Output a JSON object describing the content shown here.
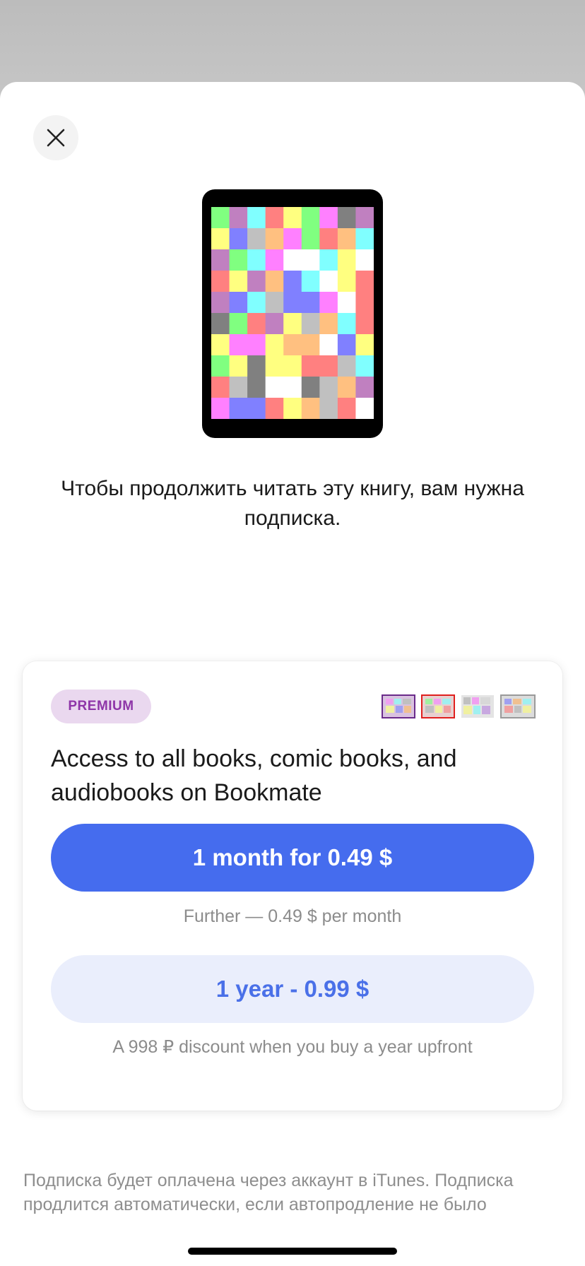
{
  "message": "Чтобы продолжить читать эту книгу, вам нужна подписка.",
  "icons": {
    "close": "close-icon",
    "book_cover": "book-cover-image"
  },
  "card": {
    "badge": "PREMIUM",
    "title": "Access to all books, comic books, and audiobooks on Bookmate",
    "monthly_button": "1 month for 0.49 $",
    "monthly_caption": "Further — 0.49 $ per month",
    "yearly_button": "1 year - 0.99 $",
    "yearly_caption": "A 998 ₽ discount when you buy a year upfront",
    "payment_methods": [
      "payment-method-1",
      "payment-method-2",
      "payment-method-3",
      "payment-method-4"
    ]
  },
  "footer": {
    "text": "Подписка будет оплачена через аккаунт в iTunes. Подписка продлится автоматически, если автопродление не было"
  },
  "colors": {
    "accent": "#456cee",
    "accent_light": "#eaeefc",
    "badge_bg": "#ead8ef",
    "badge_text": "#8e35a8",
    "muted_text": "#8c8c8c"
  }
}
